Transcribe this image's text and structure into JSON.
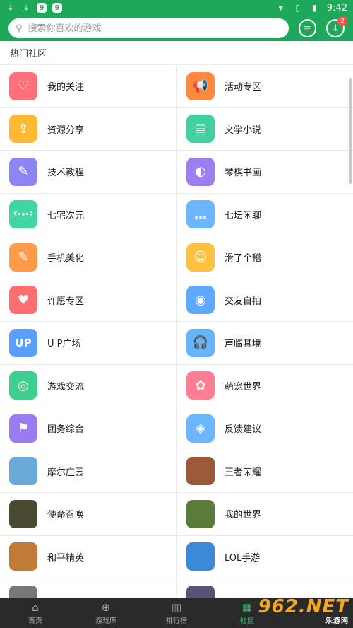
{
  "status": {
    "time": "9:42"
  },
  "search": {
    "placeholder": "搜索你喜欢的游戏"
  },
  "download_badge": "2",
  "section_title": "热门社区",
  "items": [
    {
      "label": "我的关注",
      "color": "#ff6f7a",
      "glyph": "♡"
    },
    {
      "label": "活动专区",
      "color": "#ff8a3d",
      "glyph": "📢"
    },
    {
      "label": "资源分享",
      "color": "#ffb833",
      "glyph": "⇪"
    },
    {
      "label": "文学小说",
      "color": "#41d1a0",
      "glyph": "▤"
    },
    {
      "label": "技术教程",
      "color": "#8c86f4",
      "glyph": "✎"
    },
    {
      "label": "琴棋书画",
      "color": "#9c7ef0",
      "glyph": "◐"
    },
    {
      "label": "七宅次元",
      "color": "#3fd6a3",
      "glyph": "ʕ•ᴥ•ʔ"
    },
    {
      "label": "七坛闲聊",
      "color": "#6bb6ff",
      "glyph": "…"
    },
    {
      "label": "手机美化",
      "color": "#ff9b4a",
      "glyph": "✎"
    },
    {
      "label": "滑了个稽",
      "color": "#ffc240",
      "glyph": "☺"
    },
    {
      "label": "许愿专区",
      "color": "#ff6e6e",
      "glyph": "♥"
    },
    {
      "label": "交友自拍",
      "color": "#5fa8ff",
      "glyph": "◉"
    },
    {
      "label": "U P广场",
      "color": "#5b9eff",
      "glyph": "UP"
    },
    {
      "label": "声临其境",
      "color": "#66b3ff",
      "glyph": "🎧"
    },
    {
      "label": "游戏交流",
      "color": "#3ecf8e",
      "glyph": "◎"
    },
    {
      "label": "萌宠世界",
      "color": "#ff7e93",
      "glyph": "✿"
    },
    {
      "label": "团务综合",
      "color": "#9a7cf2",
      "glyph": "⚑"
    },
    {
      "label": "反馈建议",
      "color": "#6bb6ff",
      "glyph": "◈"
    },
    {
      "label": "摩尔庄园",
      "color": "#6aa8d8",
      "glyph": ""
    },
    {
      "label": "王者荣耀",
      "color": "#9a5a3a",
      "glyph": ""
    },
    {
      "label": "使命召唤",
      "color": "#4a4a32",
      "glyph": ""
    },
    {
      "label": "我的世界",
      "color": "#5a7a3a",
      "glyph": ""
    },
    {
      "label": "和平精英",
      "color": "#c27a3a",
      "glyph": ""
    },
    {
      "label": "LOL手游",
      "color": "#3a8ad8",
      "glyph": ""
    },
    {
      "label": "…",
      "color": "#777777",
      "glyph": ""
    },
    {
      "label": "…",
      "color": "#555577",
      "glyph": ""
    }
  ],
  "nav": [
    {
      "label": "首页",
      "icon": "home-icon",
      "active": false
    },
    {
      "label": "游戏库",
      "icon": "gamepad-icon",
      "active": false
    },
    {
      "label": "排行榜",
      "icon": "ranking-icon",
      "active": false
    },
    {
      "label": "社区",
      "icon": "community-icon",
      "active": true
    }
  ],
  "watermark": {
    "text": "962.NET",
    "sub": "乐游网"
  }
}
